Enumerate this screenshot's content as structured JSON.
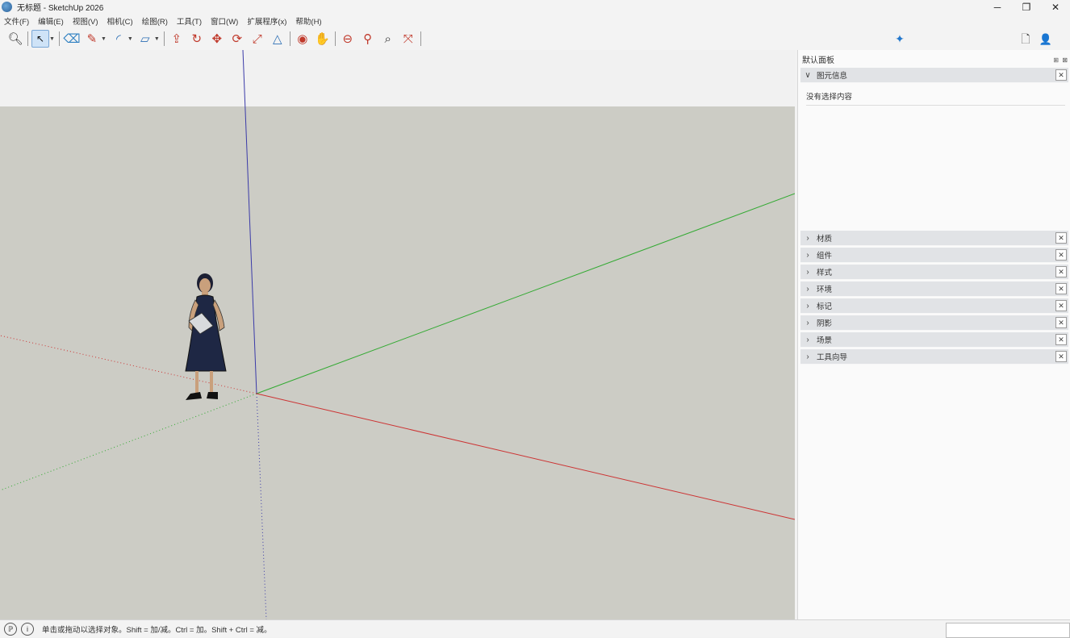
{
  "window": {
    "title": "无标题 - SketchUp 2026",
    "minimize": "─",
    "restore": "❐",
    "close": "✕"
  },
  "menu": [
    "文件(F)",
    "编辑(E)",
    "视图(V)",
    "相机(C)",
    "绘图(R)",
    "工具(T)",
    "窗口(W)",
    "扩展程序(x)",
    "帮助(H)"
  ],
  "toolbar": {
    "tools": [
      {
        "name": "zoom-window-icon",
        "glyph": "🔍︎"
      },
      {
        "name": "select-icon",
        "glyph": "↖",
        "selected": true
      },
      {
        "name": "eraser-icon",
        "glyph": "⌫"
      },
      {
        "name": "pencil-line-icon",
        "glyph": "✎"
      },
      {
        "name": "arc-icon",
        "glyph": "◜"
      },
      {
        "name": "rectangle-icon",
        "glyph": "▱"
      },
      {
        "name": "push-pull-icon",
        "glyph": "⇪"
      },
      {
        "name": "follow-me-icon",
        "glyph": "↻"
      },
      {
        "name": "move-icon",
        "glyph": "✥"
      },
      {
        "name": "rotate-icon",
        "glyph": "⟳"
      },
      {
        "name": "scale-icon",
        "glyph": "⤢"
      },
      {
        "name": "flip-icon",
        "glyph": "△"
      },
      {
        "name": "orbit-icon",
        "glyph": "◉"
      },
      {
        "name": "pan-icon",
        "glyph": "✋"
      },
      {
        "name": "section-plane-icon",
        "glyph": "⊖"
      },
      {
        "name": "tape-measure-icon",
        "glyph": "⚲"
      },
      {
        "name": "zoom-icon",
        "glyph": "⌕"
      },
      {
        "name": "zoom-extents-icon",
        "glyph": "⤧"
      }
    ],
    "ai_icon": "✦",
    "new_doc_icon": "🗋",
    "account_icon": "👤"
  },
  "tray": {
    "title": "默认面板",
    "pin": "⊞",
    "close": "⊠",
    "entity_info": {
      "label": "图元信息",
      "empty_text": "没有选择内容"
    },
    "panels": [
      "材质",
      "组件",
      "样式",
      "环境",
      "标记",
      "阴影",
      "场景",
      "工具向导"
    ]
  },
  "statusbar": {
    "text": "单击或拖动以选择对象。Shift = 加/减。Ctrl = 加。Shift + Ctrl = 减。"
  },
  "colors": {
    "ground": "#ccccc5",
    "sky": "#f1f1f1",
    "axis_red": "#cc3333",
    "axis_green": "#33aa33",
    "axis_blue": "#3a3aa8",
    "selected_tool": "#cfe3f7"
  }
}
